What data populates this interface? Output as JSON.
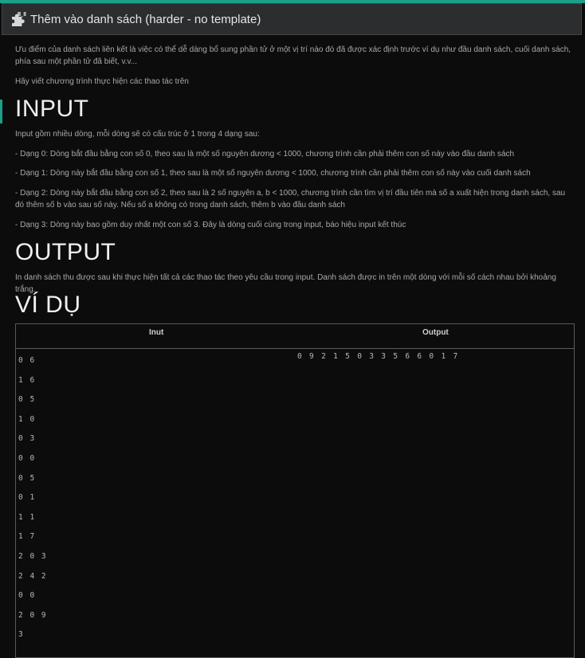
{
  "header": {
    "title": "Thêm vào danh sách (harder - no template)",
    "icon": "puzzle-icon",
    "accent_color": "#1d9f88"
  },
  "intro": "Ưu điểm của danh sách liên kết là việc có thể dễ dàng bổ sung phần tử ở một vị trí nào đó đã được xác định trước ví dụ như đầu danh sách, cuối danh sách, phía sau một phần tử đã biết, v.v...",
  "task": "Hãy viết chương trình thực hiện các thao tác trên",
  "input_section": {
    "heading": "INPUT",
    "description": "Input gồm nhiều dòng, mỗi dòng sẽ có cấu trúc ở 1 trong 4 dạng sau:",
    "forms": [
      "- Dạng 0: Dòng bắt đầu bằng con số 0, theo sau là một số nguyên dương < 1000, chương trình cần phải thêm con số này vào đầu danh sách",
      "- Dạng 1: Dòng này bắt đầu bằng con số 1, theo sau là một số nguyên dương < 1000, chương trình cần phải thêm con số này vào cuối danh sách",
      "- Dạng 2: Dòng này bắt đầu bằng con số 2, theo sau là 2 số nguyên a, b < 1000, chương trình cần tìm vị trí đầu tiên mà số a xuất hiện trong danh sách, sau đó thêm số b vào sau số này. Nếu số a không có trong danh sách, thêm b vào đầu danh sách",
      "- Dạng 3: Dòng này bao gồm duy nhất một con số 3. Đây là dòng cuối cùng trong input, báo hiệu input kết thúc"
    ]
  },
  "output_section": {
    "heading": "OUTPUT",
    "description": "In danh sách thu được sau khi thực hiện tất cả các thao tác theo yêu cầu trong input. Danh sách được in trên một dòng với mỗi số cách nhau bởi khoảng trắng."
  },
  "example": {
    "heading": "VÍ DỤ",
    "columns": [
      "Inut",
      "Output"
    ],
    "input_lines": [
      "0 6",
      "1 6",
      "0 5",
      "1 0",
      "0 3",
      "0 0",
      "0 5",
      "0 1",
      "1 1",
      "1 7",
      "2 0 3",
      "2 4 2",
      "0 0",
      "2 0 9",
      "3"
    ],
    "output": "0 9 2 1 5 0 3 3 5 6 6 0 1 7"
  }
}
